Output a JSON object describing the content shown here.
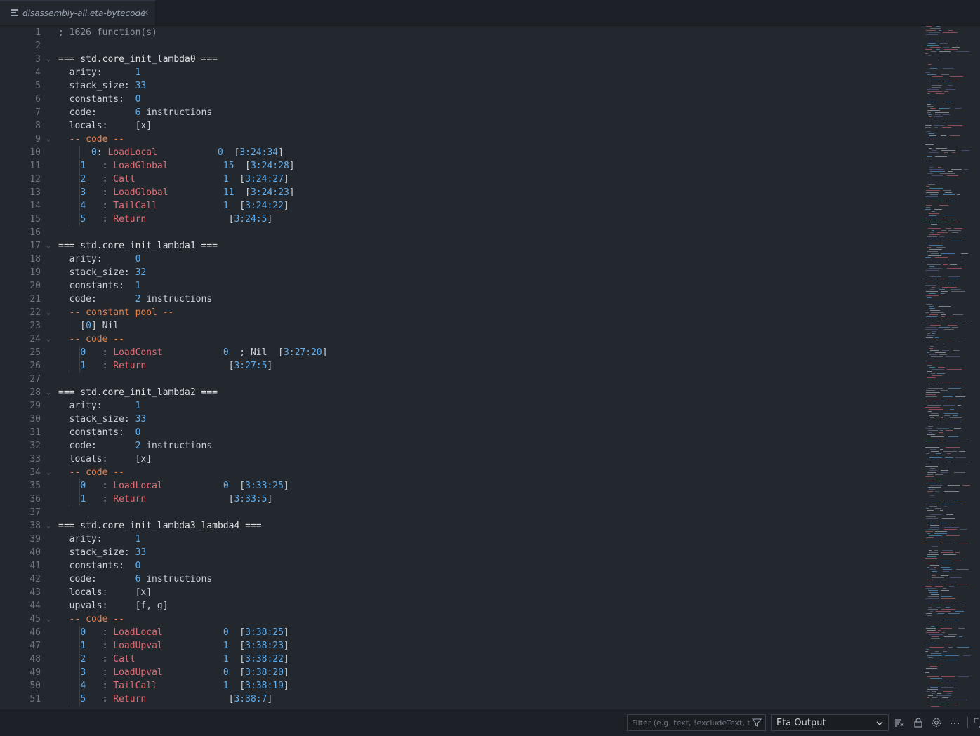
{
  "tab": {
    "title": "disassembly-all.eta-bytecode",
    "close": "×"
  },
  "lines": [
    {
      "n": "1",
      "fold": false,
      "parts": [
        [
          "comment",
          "; 1626 function(s)"
        ]
      ]
    },
    {
      "n": "2",
      "fold": false,
      "parts": []
    },
    {
      "n": "3",
      "fold": true,
      "parts": [
        [
          "head",
          "=== std.core_init_lambda0 ==="
        ]
      ]
    },
    {
      "n": "4",
      "fold": false,
      "parts": [
        [
          "key",
          "  arity:      "
        ],
        [
          "num",
          "1"
        ]
      ]
    },
    {
      "n": "5",
      "fold": false,
      "parts": [
        [
          "key",
          "  stack_size: "
        ],
        [
          "num",
          "33"
        ]
      ]
    },
    {
      "n": "6",
      "fold": false,
      "parts": [
        [
          "key",
          "  constants:  "
        ],
        [
          "num",
          "0"
        ]
      ]
    },
    {
      "n": "7",
      "fold": false,
      "parts": [
        [
          "key",
          "  code:       "
        ],
        [
          "num",
          "6"
        ],
        [
          "plain",
          " instructions"
        ]
      ]
    },
    {
      "n": "8",
      "fold": false,
      "parts": [
        [
          "key",
          "  locals:     "
        ],
        [
          "plain",
          "[x]"
        ]
      ]
    },
    {
      "n": "9",
      "fold": true,
      "parts": [
        [
          "sec",
          "  -- code --"
        ]
      ]
    },
    {
      "n": "10",
      "fold": false,
      "parts": [
        [
          "plain",
          "      "
        ],
        [
          "num",
          "0"
        ],
        [
          "plain",
          ": "
        ],
        [
          "op",
          "LoadLocal"
        ],
        [
          "plain",
          "           "
        ],
        [
          "num",
          "0"
        ],
        [
          "plain",
          "  ["
        ],
        [
          "num",
          "3:24:34"
        ],
        [
          "plain",
          "]"
        ]
      ]
    },
    {
      "n": "11",
      "fold": false,
      "parts": [
        [
          "plain",
          "    "
        ],
        [
          "num",
          "1"
        ],
        [
          "plain",
          "   : "
        ],
        [
          "op",
          "LoadGlobal"
        ],
        [
          "plain",
          "          "
        ],
        [
          "num",
          "15"
        ],
        [
          "plain",
          "  ["
        ],
        [
          "num",
          "3:24:28"
        ],
        [
          "plain",
          "]"
        ]
      ]
    },
    {
      "n": "12",
      "fold": false,
      "parts": [
        [
          "plain",
          "    "
        ],
        [
          "num",
          "2"
        ],
        [
          "plain",
          "   : "
        ],
        [
          "op",
          "Call"
        ],
        [
          "plain",
          "                "
        ],
        [
          "num",
          "1"
        ],
        [
          "plain",
          "  ["
        ],
        [
          "num",
          "3:24:27"
        ],
        [
          "plain",
          "]"
        ]
      ]
    },
    {
      "n": "13",
      "fold": false,
      "parts": [
        [
          "plain",
          "    "
        ],
        [
          "num",
          "3"
        ],
        [
          "plain",
          "   : "
        ],
        [
          "op",
          "LoadGlobal"
        ],
        [
          "plain",
          "          "
        ],
        [
          "num",
          "11"
        ],
        [
          "plain",
          "  ["
        ],
        [
          "num",
          "3:24:23"
        ],
        [
          "plain",
          "]"
        ]
      ]
    },
    {
      "n": "14",
      "fold": false,
      "parts": [
        [
          "plain",
          "    "
        ],
        [
          "num",
          "4"
        ],
        [
          "plain",
          "   : "
        ],
        [
          "op",
          "TailCall"
        ],
        [
          "plain",
          "            "
        ],
        [
          "num",
          "1"
        ],
        [
          "plain",
          "  ["
        ],
        [
          "num",
          "3:24:22"
        ],
        [
          "plain",
          "]"
        ]
      ]
    },
    {
      "n": "15",
      "fold": false,
      "parts": [
        [
          "plain",
          "    "
        ],
        [
          "num",
          "5"
        ],
        [
          "plain",
          "   : "
        ],
        [
          "op",
          "Return"
        ],
        [
          "plain",
          "               ["
        ],
        [
          "num",
          "3:24:5"
        ],
        [
          "plain",
          "]"
        ]
      ]
    },
    {
      "n": "16",
      "fold": false,
      "parts": []
    },
    {
      "n": "17",
      "fold": true,
      "parts": [
        [
          "head",
          "=== std.core_init_lambda1 ==="
        ]
      ]
    },
    {
      "n": "18",
      "fold": false,
      "parts": [
        [
          "key",
          "  arity:      "
        ],
        [
          "num",
          "0"
        ]
      ]
    },
    {
      "n": "19",
      "fold": false,
      "parts": [
        [
          "key",
          "  stack_size: "
        ],
        [
          "num",
          "32"
        ]
      ]
    },
    {
      "n": "20",
      "fold": false,
      "parts": [
        [
          "key",
          "  constants:  "
        ],
        [
          "num",
          "1"
        ]
      ]
    },
    {
      "n": "21",
      "fold": false,
      "parts": [
        [
          "key",
          "  code:       "
        ],
        [
          "num",
          "2"
        ],
        [
          "plain",
          " instructions"
        ]
      ]
    },
    {
      "n": "22",
      "fold": true,
      "parts": [
        [
          "sec",
          "  -- constant pool --"
        ]
      ]
    },
    {
      "n": "23",
      "fold": false,
      "parts": [
        [
          "plain",
          "    ["
        ],
        [
          "num",
          "0"
        ],
        [
          "plain",
          "] Nil"
        ]
      ]
    },
    {
      "n": "24",
      "fold": true,
      "parts": [
        [
          "sec",
          "  -- code --"
        ]
      ]
    },
    {
      "n": "25",
      "fold": false,
      "parts": [
        [
          "plain",
          "    "
        ],
        [
          "num",
          "0"
        ],
        [
          "plain",
          "   : "
        ],
        [
          "op",
          "LoadConst"
        ],
        [
          "plain",
          "           "
        ],
        [
          "num",
          "0"
        ],
        [
          "plain",
          "  ; Nil  ["
        ],
        [
          "num",
          "3:27:20"
        ],
        [
          "plain",
          "]"
        ]
      ]
    },
    {
      "n": "26",
      "fold": false,
      "parts": [
        [
          "plain",
          "    "
        ],
        [
          "num",
          "1"
        ],
        [
          "plain",
          "   : "
        ],
        [
          "op",
          "Return"
        ],
        [
          "plain",
          "               ["
        ],
        [
          "num",
          "3:27:5"
        ],
        [
          "plain",
          "]"
        ]
      ]
    },
    {
      "n": "27",
      "fold": false,
      "parts": []
    },
    {
      "n": "28",
      "fold": true,
      "parts": [
        [
          "head",
          "=== std.core_init_lambda2 ==="
        ]
      ]
    },
    {
      "n": "29",
      "fold": false,
      "parts": [
        [
          "key",
          "  arity:      "
        ],
        [
          "num",
          "1"
        ]
      ]
    },
    {
      "n": "30",
      "fold": false,
      "parts": [
        [
          "key",
          "  stack_size: "
        ],
        [
          "num",
          "33"
        ]
      ]
    },
    {
      "n": "31",
      "fold": false,
      "parts": [
        [
          "key",
          "  constants:  "
        ],
        [
          "num",
          "0"
        ]
      ]
    },
    {
      "n": "32",
      "fold": false,
      "parts": [
        [
          "key",
          "  code:       "
        ],
        [
          "num",
          "2"
        ],
        [
          "plain",
          " instructions"
        ]
      ]
    },
    {
      "n": "33",
      "fold": false,
      "parts": [
        [
          "key",
          "  locals:     "
        ],
        [
          "plain",
          "[x]"
        ]
      ]
    },
    {
      "n": "34",
      "fold": true,
      "parts": [
        [
          "sec",
          "  -- code --"
        ]
      ]
    },
    {
      "n": "35",
      "fold": false,
      "parts": [
        [
          "plain",
          "    "
        ],
        [
          "num",
          "0"
        ],
        [
          "plain",
          "   : "
        ],
        [
          "op",
          "LoadLocal"
        ],
        [
          "plain",
          "           "
        ],
        [
          "num",
          "0"
        ],
        [
          "plain",
          "  ["
        ],
        [
          "num",
          "3:33:25"
        ],
        [
          "plain",
          "]"
        ]
      ]
    },
    {
      "n": "36",
      "fold": false,
      "parts": [
        [
          "plain",
          "    "
        ],
        [
          "num",
          "1"
        ],
        [
          "plain",
          "   : "
        ],
        [
          "op",
          "Return"
        ],
        [
          "plain",
          "               ["
        ],
        [
          "num",
          "3:33:5"
        ],
        [
          "plain",
          "]"
        ]
      ]
    },
    {
      "n": "37",
      "fold": false,
      "parts": []
    },
    {
      "n": "38",
      "fold": true,
      "parts": [
        [
          "head",
          "=== std.core_init_lambda3_lambda4 ==="
        ]
      ]
    },
    {
      "n": "39",
      "fold": false,
      "parts": [
        [
          "key",
          "  arity:      "
        ],
        [
          "num",
          "1"
        ]
      ]
    },
    {
      "n": "40",
      "fold": false,
      "parts": [
        [
          "key",
          "  stack_size: "
        ],
        [
          "num",
          "33"
        ]
      ]
    },
    {
      "n": "41",
      "fold": false,
      "parts": [
        [
          "key",
          "  constants:  "
        ],
        [
          "num",
          "0"
        ]
      ]
    },
    {
      "n": "42",
      "fold": false,
      "parts": [
        [
          "key",
          "  code:       "
        ],
        [
          "num",
          "6"
        ],
        [
          "plain",
          " instructions"
        ]
      ]
    },
    {
      "n": "43",
      "fold": false,
      "parts": [
        [
          "key",
          "  locals:     "
        ],
        [
          "plain",
          "[x]"
        ]
      ]
    },
    {
      "n": "44",
      "fold": false,
      "parts": [
        [
          "key",
          "  upvals:     "
        ],
        [
          "plain",
          "[f, g]"
        ]
      ]
    },
    {
      "n": "45",
      "fold": true,
      "parts": [
        [
          "sec",
          "  -- code --"
        ]
      ]
    },
    {
      "n": "46",
      "fold": false,
      "parts": [
        [
          "plain",
          "    "
        ],
        [
          "num",
          "0"
        ],
        [
          "plain",
          "   : "
        ],
        [
          "op",
          "LoadLocal"
        ],
        [
          "plain",
          "           "
        ],
        [
          "num",
          "0"
        ],
        [
          "plain",
          "  ["
        ],
        [
          "num",
          "3:38:25"
        ],
        [
          "plain",
          "]"
        ]
      ]
    },
    {
      "n": "47",
      "fold": false,
      "parts": [
        [
          "plain",
          "    "
        ],
        [
          "num",
          "1"
        ],
        [
          "plain",
          "   : "
        ],
        [
          "op",
          "LoadUpval"
        ],
        [
          "plain",
          "           "
        ],
        [
          "num",
          "1"
        ],
        [
          "plain",
          "  ["
        ],
        [
          "num",
          "3:38:23"
        ],
        [
          "plain",
          "]"
        ]
      ]
    },
    {
      "n": "48",
      "fold": false,
      "parts": [
        [
          "plain",
          "    "
        ],
        [
          "num",
          "2"
        ],
        [
          "plain",
          "   : "
        ],
        [
          "op",
          "Call"
        ],
        [
          "plain",
          "                "
        ],
        [
          "num",
          "1"
        ],
        [
          "plain",
          "  ["
        ],
        [
          "num",
          "3:38:22"
        ],
        [
          "plain",
          "]"
        ]
      ]
    },
    {
      "n": "49",
      "fold": false,
      "parts": [
        [
          "plain",
          "    "
        ],
        [
          "num",
          "3"
        ],
        [
          "plain",
          "   : "
        ],
        [
          "op",
          "LoadUpval"
        ],
        [
          "plain",
          "           "
        ],
        [
          "num",
          "0"
        ],
        [
          "plain",
          "  ["
        ],
        [
          "num",
          "3:38:20"
        ],
        [
          "plain",
          "]"
        ]
      ]
    },
    {
      "n": "50",
      "fold": false,
      "parts": [
        [
          "plain",
          "    "
        ],
        [
          "num",
          "4"
        ],
        [
          "plain",
          "   : "
        ],
        [
          "op",
          "TailCall"
        ],
        [
          "plain",
          "            "
        ],
        [
          "num",
          "1"
        ],
        [
          "plain",
          "  ["
        ],
        [
          "num",
          "3:38:19"
        ],
        [
          "plain",
          "]"
        ]
      ]
    },
    {
      "n": "51",
      "fold": false,
      "parts": [
        [
          "plain",
          "    "
        ],
        [
          "num",
          "5"
        ],
        [
          "plain",
          "   : "
        ],
        [
          "op",
          "Return"
        ],
        [
          "plain",
          "               ["
        ],
        [
          "num",
          "3:38:7"
        ],
        [
          "plain",
          "]"
        ]
      ]
    }
  ],
  "panel": {
    "filter_placeholder": "Filter (e.g. text, !excludeText, t...",
    "channel": "Eta Output"
  },
  "colors": {
    "background": "#23272e",
    "number": "#61afef",
    "opcode": "#e06c75",
    "section": "#e5834a"
  }
}
